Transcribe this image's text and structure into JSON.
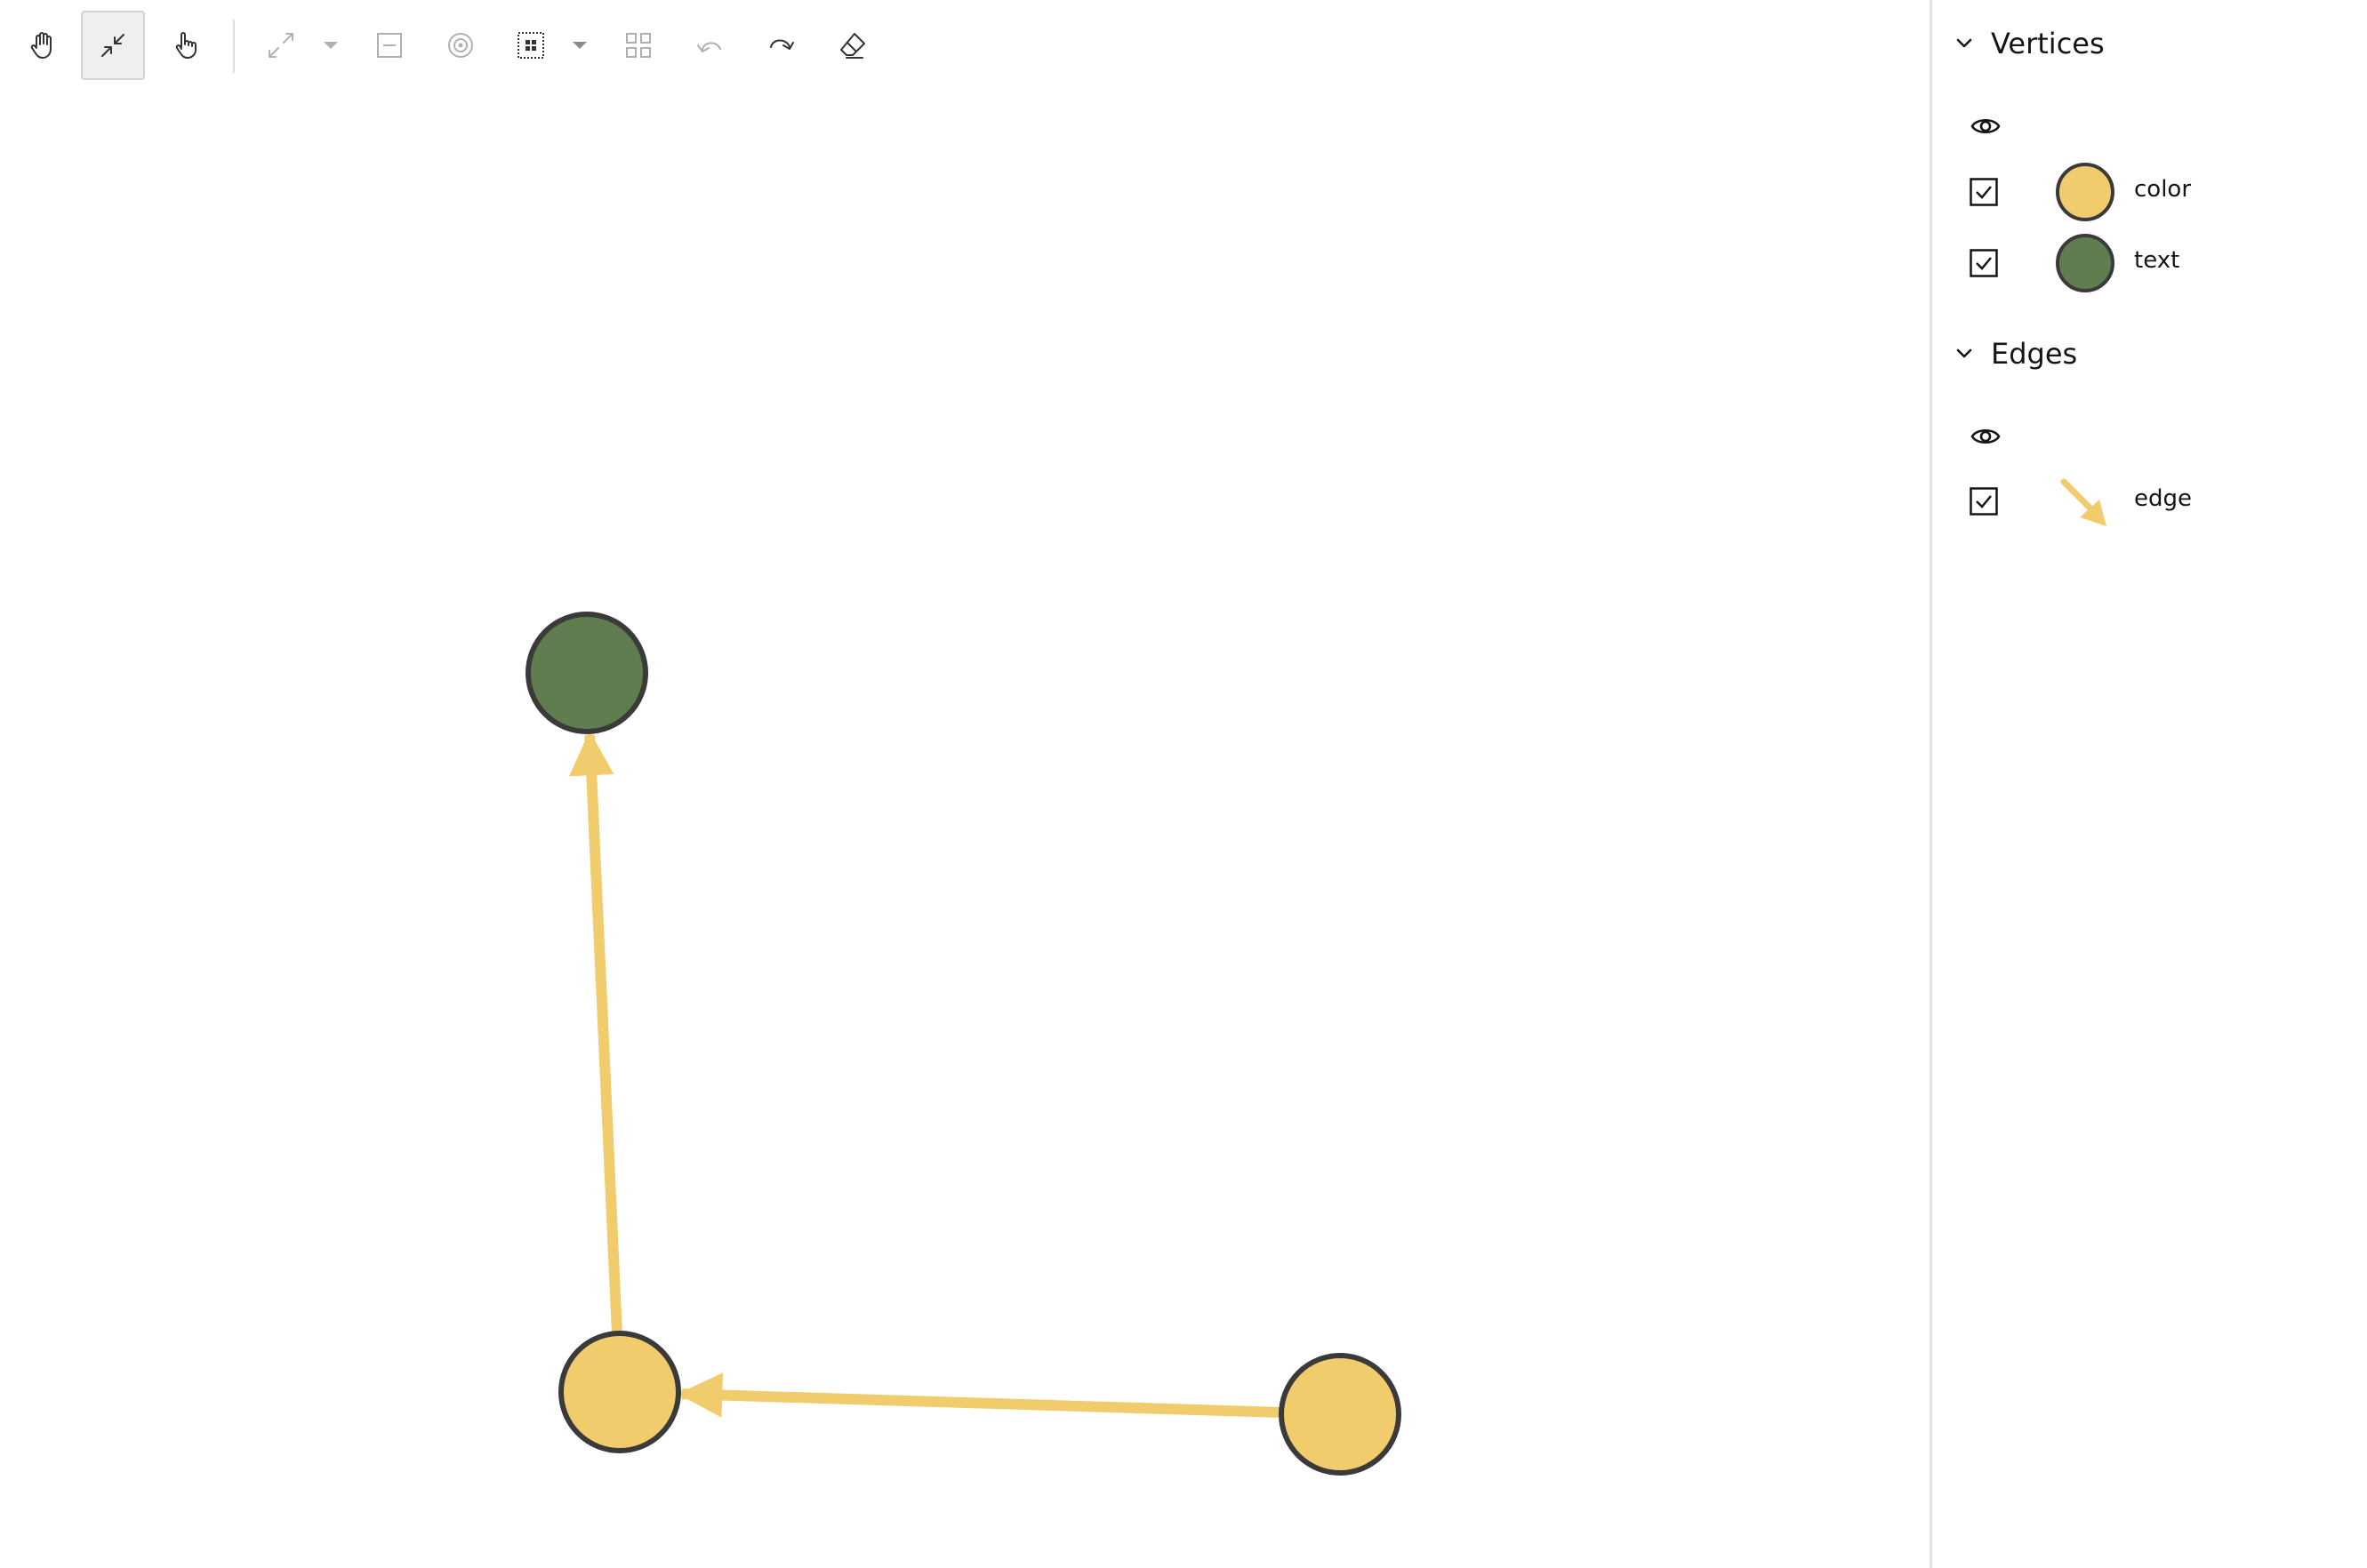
{
  "toolbar": {
    "tools": [
      {
        "id": "pan",
        "icon": "hand-icon",
        "title": "Pan",
        "state": "normal"
      },
      {
        "id": "zoom-to-fit",
        "icon": "collapse-arrows-icon",
        "title": "Zoom to fit",
        "state": "active"
      },
      {
        "id": "select",
        "icon": "pointer-hand-icon",
        "title": "Select",
        "state": "normal"
      },
      {
        "id": "expand",
        "icon": "expand-arrows-icon",
        "title": "Expand",
        "state": "disabled"
      },
      {
        "id": "collapse",
        "icon": "minus-box-icon",
        "title": "Collapse",
        "state": "disabled"
      },
      {
        "id": "focus",
        "icon": "target-icon",
        "title": "Focus",
        "state": "disabled"
      },
      {
        "id": "group",
        "icon": "group-select-icon",
        "title": "Group",
        "state": "normal"
      },
      {
        "id": "ungroup",
        "icon": "grid-icon",
        "title": "Ungroup",
        "state": "disabled"
      },
      {
        "id": "undo",
        "icon": "undo-icon",
        "title": "Undo",
        "state": "disabled"
      },
      {
        "id": "redo",
        "icon": "redo-icon",
        "title": "Redo",
        "state": "normal"
      },
      {
        "id": "clear",
        "icon": "eraser-icon",
        "title": "Clear",
        "state": "normal"
      }
    ]
  },
  "legend": {
    "vertices": {
      "title": "Vertices",
      "items": [
        {
          "label": "color",
          "color": "#f0cc6d",
          "checked": true
        },
        {
          "label": "text",
          "color": "#5f7d4f",
          "checked": true
        }
      ]
    },
    "edges": {
      "title": "Edges",
      "items": [
        {
          "label": "edge",
          "color": "#f0cc6d",
          "checked": true
        }
      ]
    }
  },
  "graph": {
    "vertices": [
      {
        "id": "v1",
        "group": "text",
        "fill": "#5f7d4f"
      },
      {
        "id": "v2",
        "group": "color",
        "fill": "#f0cc6d"
      },
      {
        "id": "v3",
        "group": "color",
        "fill": "#f0cc6d"
      }
    ],
    "edges": [
      {
        "source": "v2",
        "target": "v1",
        "color": "#f0cc6d"
      },
      {
        "source": "v3",
        "target": "v2",
        "color": "#f0cc6d"
      }
    ],
    "vertex_stroke": "#3a3a3a"
  }
}
